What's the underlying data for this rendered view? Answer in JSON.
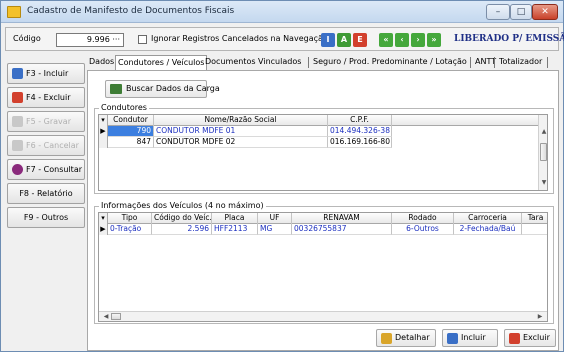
{
  "window": {
    "title": "Cadastro de Manifesto de Documentos Fiscais",
    "controls": {
      "minimize": "–",
      "maximize": "□",
      "close": "✕"
    }
  },
  "toolbar": {
    "codigo_label": "Código",
    "codigo_value": "9.996",
    "codigo_lookup": "···",
    "ignorar_label": "Ignorar Registros Cancelados na Navegação",
    "ignorar_checked": false,
    "nav_buttons": [
      {
        "label": "I",
        "color": "#3a6fc6"
      },
      {
        "label": "A",
        "color": "#3f9b36"
      },
      {
        "label": "E",
        "color": "#d2402d"
      },
      {
        "label": "«",
        "color": "#45a83c"
      },
      {
        "label": "‹",
        "color": "#45a83c"
      },
      {
        "label": "›",
        "color": "#45a83c"
      },
      {
        "label": "»",
        "color": "#45a83c"
      }
    ],
    "status_text": "LIBERADO P/ EMISSÃO"
  },
  "sidebar": {
    "buttons": [
      {
        "label": "F3 - Incluir",
        "enabled": true,
        "icon_color": "#3a6fc6"
      },
      {
        "label": "F4 - Excluir",
        "enabled": true,
        "icon_color": "#d2402d"
      },
      {
        "label": "F5 - Gravar",
        "enabled": false,
        "icon_color": "#c8c8c8"
      },
      {
        "label": "F6 - Cancelar",
        "enabled": false,
        "icon_color": "#c8c8c8"
      },
      {
        "label": "F7 - Consultar",
        "enabled": true,
        "icon_color": "#8a2a7c"
      },
      {
        "label": "F8 - Relatório",
        "enabled": true
      },
      {
        "label": "F9 - Outros",
        "enabled": true
      }
    ]
  },
  "tabs": [
    "Dados",
    "Condutores / Veículos",
    "Documentos Vinculados",
    "Seguro / Prod. Predominante / Lotação",
    "ANTT",
    "Totalizador"
  ],
  "active_tab": 1,
  "buscar_label": "Buscar Dados da Carga",
  "condutores": {
    "title": "Condutores",
    "columns": [
      "Condutor",
      "Nome/Razão Social",
      "C.P.F."
    ],
    "rows": [
      {
        "codigo": "790",
        "nome": "CONDUTOR MDFE 01",
        "cpf": "014.494.326-38"
      },
      {
        "codigo": "847",
        "nome": "CONDUTOR MDFE 02",
        "cpf": "016.169.166-80"
      }
    ]
  },
  "veiculos": {
    "title": "Informações dos Veículos (4 no máximo)",
    "columns": [
      "Tipo",
      "Código do Veíc...",
      "Placa",
      "UF",
      "RENAVAM",
      "Rodado",
      "Carroceria",
      "Tara"
    ],
    "rows": [
      {
        "tipo": "0-Tração",
        "codigo": "2.596",
        "placa": "HFF2113",
        "uf": "MG",
        "renavam": "00326755837",
        "rodado": "6-Outros",
        "carroceria": "2-Fechada/Baú",
        "tara": ""
      }
    ]
  },
  "bottom_buttons": {
    "detalhar": "Detalhar",
    "incluir": "Incluir",
    "excluir": "Excluir"
  }
}
